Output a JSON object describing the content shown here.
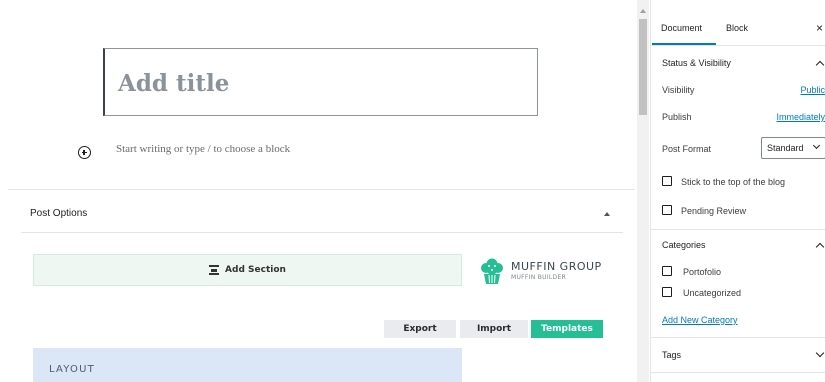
{
  "editor": {
    "title_placeholder": "Add title",
    "block_placeholder": "Start writing or type / to choose a block"
  },
  "post_options": {
    "title": "Post Options",
    "add_section_label": "Add Section",
    "brand": {
      "name": "MUFFIN GROUP",
      "subtitle": "MUFFIN BUILDER",
      "color": "#26bf95"
    },
    "buttons": {
      "export": "Export",
      "import": "Import",
      "templates": "Templates"
    },
    "layout_label": "LAYOUT"
  },
  "sidebar": {
    "tabs": {
      "document": "Document",
      "block": "Block"
    },
    "close_glyph": "×",
    "status_visibility": {
      "title": "Status & Visibility",
      "visibility_label": "Visibility",
      "visibility_value": "Public",
      "publish_label": "Publish",
      "publish_value": "Immediately",
      "post_format_label": "Post Format",
      "post_format_value": "Standard",
      "stick_top": "Stick to the top of the blog",
      "pending_review": "Pending Review"
    },
    "categories": {
      "title": "Categories",
      "items": [
        "Portofolio",
        "Uncategorized"
      ],
      "add_new": "Add New Category"
    },
    "tags": {
      "title": "Tags"
    }
  },
  "colors": {
    "accent": "#007cba",
    "templates_button": "#26bf95",
    "layout_bg": "#dbe6f7",
    "add_section_bg": "#eef7f2"
  }
}
